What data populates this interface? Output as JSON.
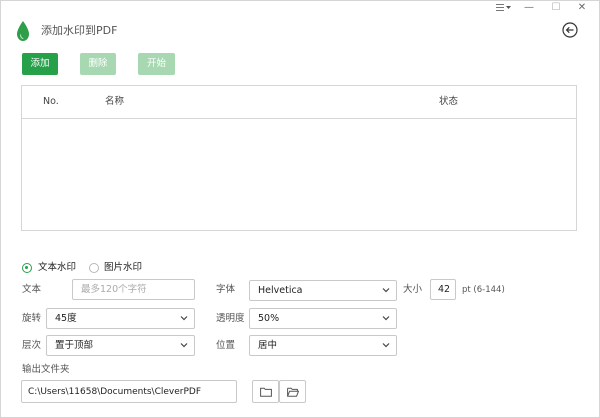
{
  "window": {
    "title": "添加水印到PDF",
    "menu_icon": "menu-dropdown-icon",
    "minimize": "—",
    "maximize": "☐",
    "close": "✕"
  },
  "toolbar": {
    "add_label": "添加",
    "delete_label": "删除",
    "start_label": "开始"
  },
  "table": {
    "columns": [
      "No.",
      "名称",
      "状态"
    ],
    "rows": []
  },
  "watermark_type": {
    "text_option": "文本水印",
    "image_option": "图片水印",
    "selected": "text"
  },
  "form": {
    "text_label": "文本",
    "text_placeholder": "最多120个字符",
    "text_value": "",
    "font_label": "字体",
    "font_value": "Helvetica",
    "size_label": "大小",
    "size_value": "42",
    "size_hint": "pt (6-144)",
    "rotation_label": "旋转",
    "rotation_value": "45度",
    "opacity_label": "透明度",
    "opacity_value": "50%",
    "layer_label": "层次",
    "layer_value": "置于顶部",
    "position_label": "位置",
    "position_value": "居中"
  },
  "output": {
    "label": "输出文件夹",
    "path": "C:\\Users\\11658\\Documents\\CleverPDF"
  },
  "colors": {
    "accent": "#27a04a",
    "accent_disabled": "#a7d8b1",
    "logo": "#2e9e48"
  }
}
